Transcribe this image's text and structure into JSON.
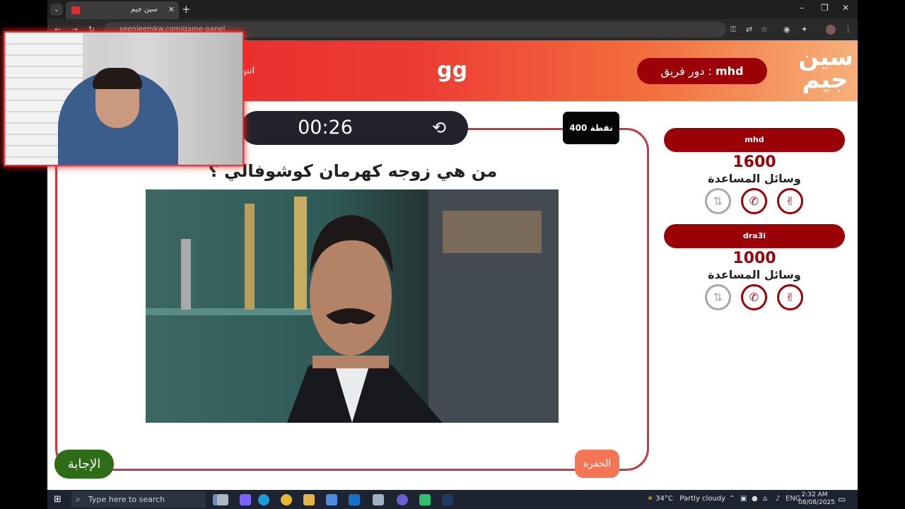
{
  "browser": {
    "tab_title": "سين جيم",
    "new_tab": "+",
    "url": "seenjeemkw.com/game-panel",
    "win_min": "–",
    "win_max": "❐",
    "win_close": "✕"
  },
  "header": {
    "turn_label": "دور فريق :",
    "turn_team": "mhd",
    "room_name": "gg",
    "end_label": "انتها",
    "logo_line1": "سين",
    "logo_line2": "جيم"
  },
  "question": {
    "timer": "00:26",
    "points": "400 نقطة",
    "text": "من هي زوجه كهرمان كوشوفالي ؟",
    "pit_label": "الحفرة",
    "answer_label": "الإجابة"
  },
  "teams": [
    {
      "name": "mhd",
      "score": "1600",
      "aids_label": "وسائل المساعدة"
    },
    {
      "name": "dra3i",
      "score": "1000",
      "aids_label": "وسائل المساعدة"
    }
  ],
  "taskbar": {
    "search_placeholder": "Type here to search",
    "temperature": "34°C",
    "weather": "Partly cloudy",
    "language": "ENG",
    "time": "2:32 AM",
    "date": "08/08/2025"
  },
  "colors": {
    "brand_red": "#9a0208",
    "header_start": "#e6232a",
    "header_end": "#f6b07a",
    "answer_green": "#2f6c17",
    "pit_orange": "#f37556"
  }
}
